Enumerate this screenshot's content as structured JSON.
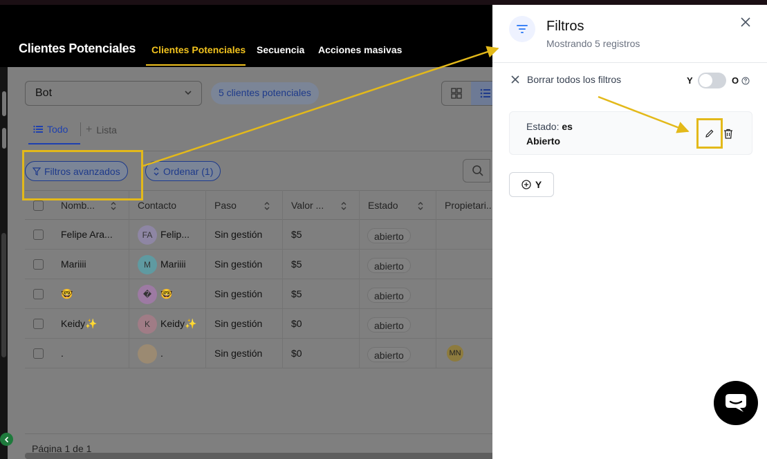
{
  "header": {
    "app_title": "Clientes Potenciales",
    "tabs": [
      {
        "label": "Clientes Potenciales",
        "active": true
      },
      {
        "label": "Secuencia",
        "active": false
      },
      {
        "label": "Acciones masivas",
        "active": false
      }
    ]
  },
  "toolbar": {
    "pipeline_select": "Bot",
    "count_badge": "5 clientes potenciales"
  },
  "views": {
    "todo": "Todo",
    "lista": "Lista"
  },
  "filters_bar": {
    "advanced_filters": "Filtros avanzados",
    "sort": "Ordenar (1)"
  },
  "table": {
    "columns": [
      "Nomb...",
      "Contacto",
      "Paso",
      "Valor ...",
      "Estado",
      "Propietari..."
    ],
    "rows": [
      {
        "name": "Felipe Ara...",
        "initials": "FA",
        "contact": "Felip...",
        "step": "Sin gestión",
        "value": "$5",
        "status": "abierto",
        "owner": ""
      },
      {
        "name": "Mariiii",
        "initials": "M",
        "contact": "Mariiii",
        "step": "Sin gestión",
        "value": "$5",
        "status": "abierto",
        "owner": ""
      },
      {
        "name": "🤓",
        "initials": "�",
        "contact": "🤓",
        "step": "Sin gestión",
        "value": "$5",
        "status": "abierto",
        "owner": ""
      },
      {
        "name": "Keidy✨",
        "initials": "K",
        "contact": "Keidy✨",
        "step": "Sin gestión",
        "value": "$0",
        "status": "abierto",
        "owner": ""
      },
      {
        "name": ".",
        "initials": "",
        "contact": ".",
        "step": "Sin gestión",
        "value": "$0",
        "status": "abierto",
        "owner": "MN"
      }
    ],
    "pager": "Página 1 de 1"
  },
  "panel": {
    "title": "Filtros",
    "subtitle": "Mostrando 5 registros",
    "clear_all": "Borrar todos los filtros",
    "y_label": "Y",
    "o_label": "O",
    "condition": {
      "field": "Estado:",
      "operator": "es",
      "value": "Abierto"
    },
    "add_button": "Y"
  },
  "colors": {
    "accent_yellow": "#e3b91a",
    "link_blue": "#1e40af",
    "header_bg": "#000000"
  }
}
